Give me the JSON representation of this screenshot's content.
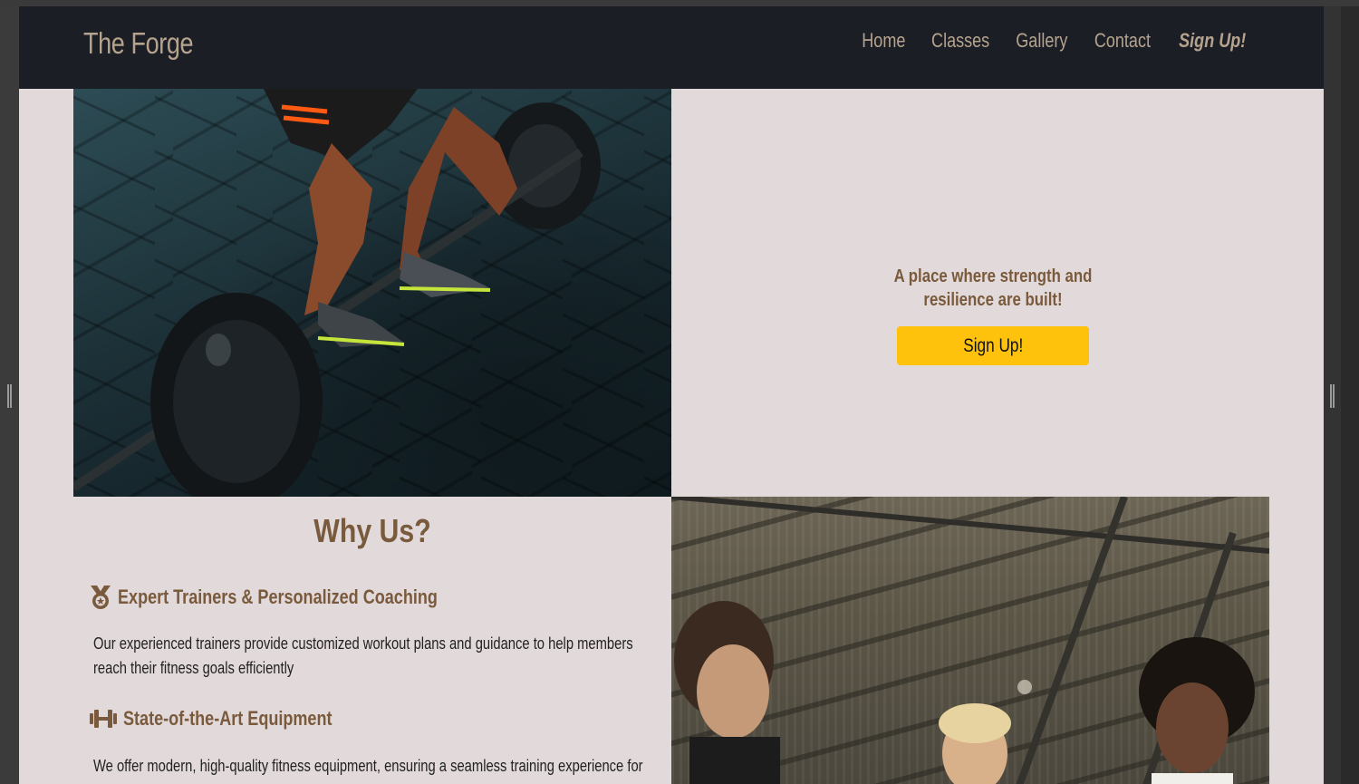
{
  "brand": "The Forge",
  "nav": {
    "home": "Home",
    "classes": "Classes",
    "gallery": "Gallery",
    "contact": "Contact",
    "signup": "Sign Up!"
  },
  "hero": {
    "tagline": "A place where strength and resilience are built!",
    "button": "Sign Up!"
  },
  "why": {
    "title": "Why Us?",
    "features": [
      {
        "icon": "medal-icon",
        "title": "Expert Trainers & Personalized Coaching",
        "text": "Our experienced trainers provide customized workout plans and guidance to help members reach their fitness goals efficiently"
      },
      {
        "icon": "dumbbell-icon",
        "title": "State-of-the-Art Equipment",
        "text": "We offer modern, high-quality fitness equipment, ensuring a seamless training experience for"
      }
    ]
  },
  "colors": {
    "navbar": "#1c1e26",
    "brand_text": "#b6a38d",
    "page_bg": "#e2d9da",
    "heading": "#7a5a3c",
    "cta": "#fec20c"
  }
}
